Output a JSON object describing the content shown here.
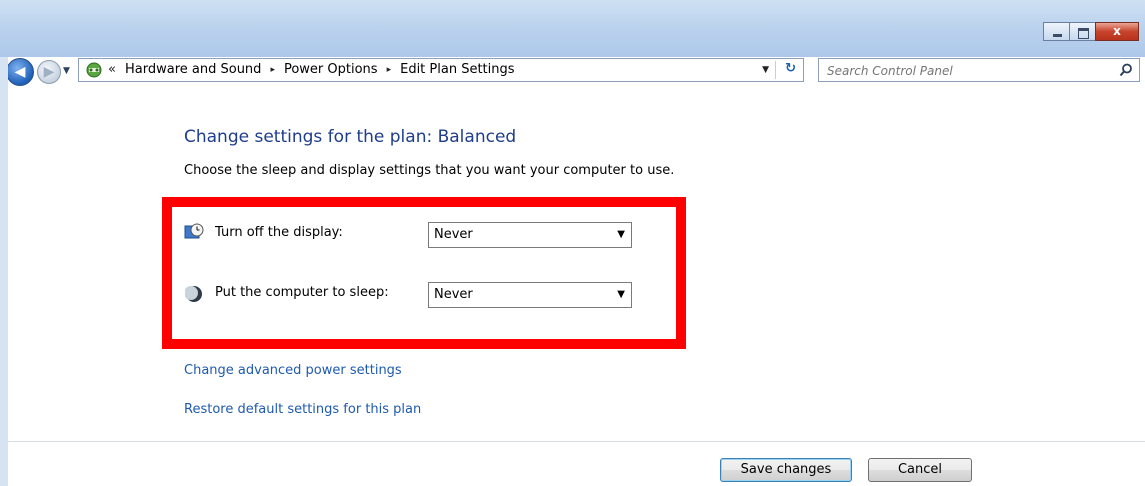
{
  "window": {
    "controls": {
      "minimize": "minimize",
      "maximize": "maximize",
      "close": "x"
    }
  },
  "nav": {
    "back_icon": "back-arrow-icon",
    "forward_icon": "forward-arrow-icon"
  },
  "address": {
    "overflow": "«",
    "crumbs": [
      "Hardware and Sound",
      "Power Options",
      "Edit Plan Settings"
    ],
    "separator": "▸"
  },
  "search": {
    "placeholder": "Search Control Panel"
  },
  "main": {
    "heading": "Change settings for the plan: Balanced",
    "subtext": "Choose the sleep and display settings that you want your computer to use.",
    "settings": [
      {
        "label": "Turn off the display:",
        "value": "Never",
        "icon": "display-timer-icon"
      },
      {
        "label": "Put the computer to sleep:",
        "value": "Never",
        "icon": "sleep-moon-icon"
      }
    ],
    "links": [
      "Change advanced power settings",
      "Restore default settings for this plan"
    ],
    "highlight_color": "#ff0000"
  },
  "buttons": {
    "save": "Save changes",
    "cancel": "Cancel"
  }
}
